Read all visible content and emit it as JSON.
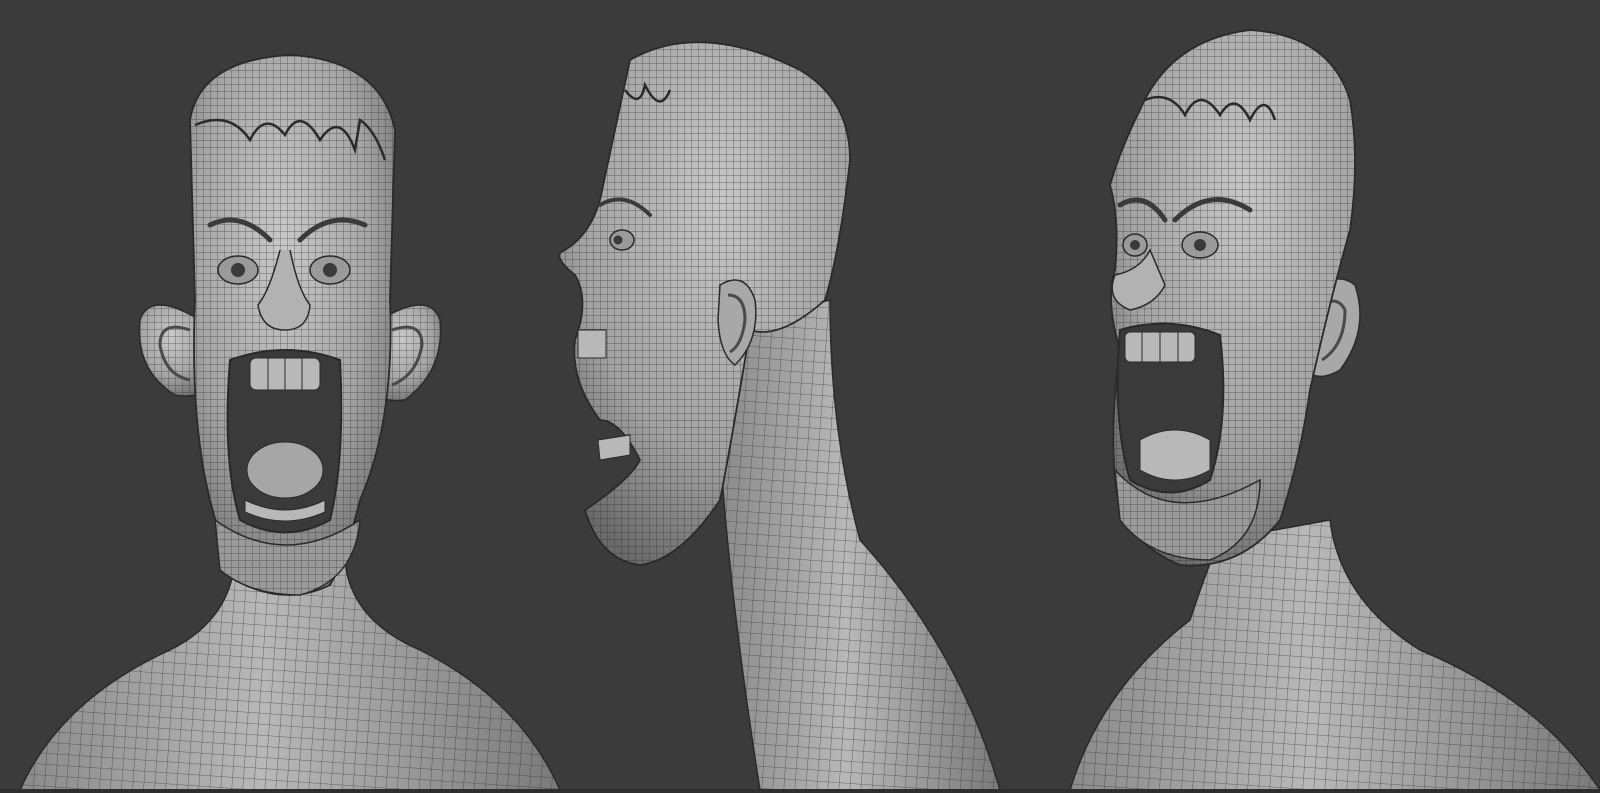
{
  "scene": {
    "subject": "wireframe-sculpt-head",
    "views": [
      {
        "id": "front",
        "icon": "front-view-head"
      },
      {
        "id": "side",
        "icon": "side-view-head"
      },
      {
        "id": "three-quarter",
        "icon": "three-quarter-view-head"
      }
    ]
  },
  "colors": {
    "background": "#3b3b3b",
    "skin": "#a6a6a6",
    "skin_light": "#c4c4c4",
    "skin_dark": "#6e6e6e",
    "wire": "#2a2a2a",
    "mouth_inside": "#3a3a3a"
  }
}
